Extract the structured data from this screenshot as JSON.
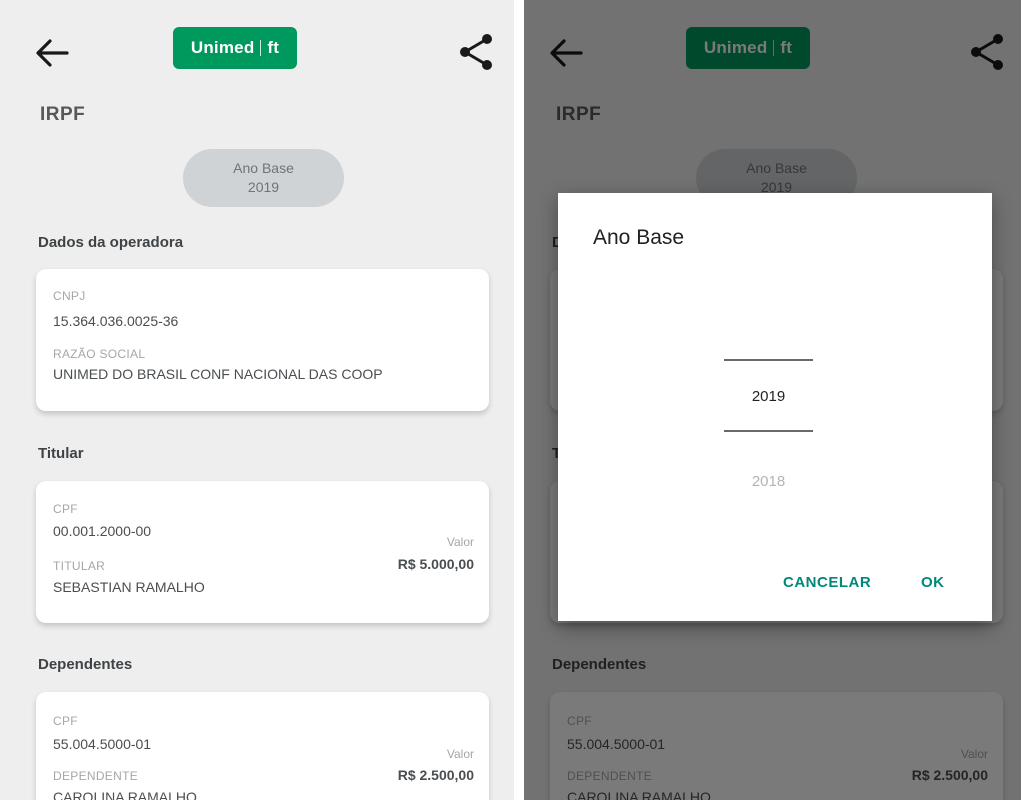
{
  "header": {
    "back_icon": "arrow-left-icon",
    "logo_text": "Unimed",
    "logo_mark": "ft",
    "share_icon": "share-icon",
    "brand_color": "#00995d"
  },
  "page_title": "IRPF",
  "year_selector": {
    "label": "Ano Base",
    "value": "2019"
  },
  "operadora": {
    "section_title": "Dados da operadora",
    "cnpj_label": "CNPJ",
    "cnpj_value": "15.364.036.0025-36",
    "razao_label": "RAZÃO SOCIAL",
    "razao_value": "UNIMED DO BRASIL CONF NACIONAL DAS COOP"
  },
  "titular": {
    "section_title": "Titular",
    "cpf_label": "CPF",
    "cpf_value": "00.001.2000-00",
    "role_label": "TITULAR",
    "name": "SEBASTIAN RAMALHO",
    "valor_label": "Valor",
    "valor": "R$ 5.000,00"
  },
  "dependentes": {
    "section_title": "Dependentes",
    "cpf_label": "CPF",
    "cpf_value": "55.004.5000-01",
    "role_label": "DEPENDENTE",
    "name": "CAROLINA RAMALHO",
    "valor_label": "Valor",
    "valor": "R$ 2.500,00"
  },
  "dialog": {
    "title": "Ano Base",
    "selected_year": "2019",
    "next_year": "2018",
    "cancel_label": "CANCELAR",
    "ok_label": "OK",
    "accent_color": "#00897b"
  }
}
